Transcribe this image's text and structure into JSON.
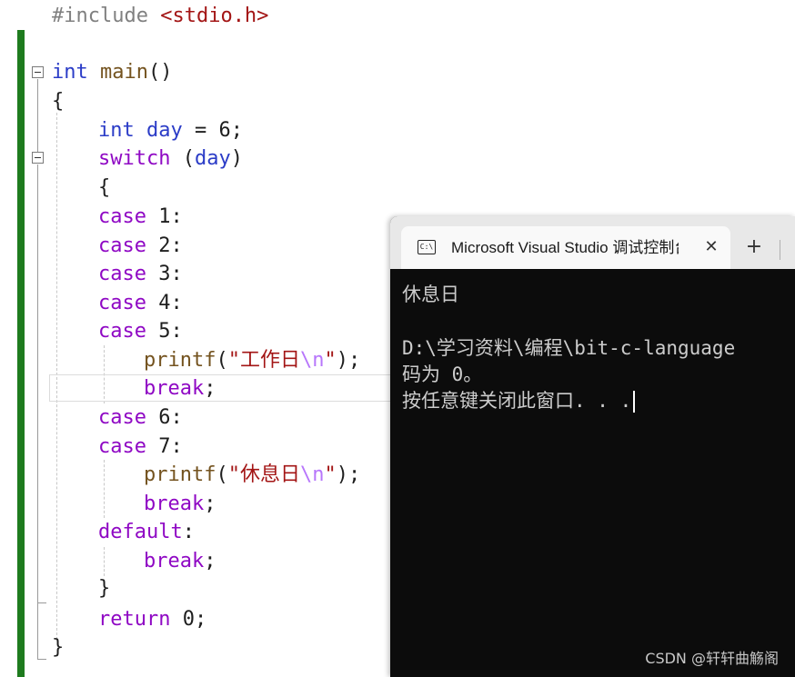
{
  "editor": {
    "lines": [
      {
        "id": "l1",
        "parts": [
          {
            "c": "pp",
            "t": "#include "
          },
          {
            "c": "str",
            "t": "<stdio.h>"
          }
        ]
      },
      {
        "id": "l2",
        "parts": []
      },
      {
        "id": "l3",
        "parts": [
          {
            "c": "kw",
            "t": "int"
          },
          {
            "c": "punct",
            "t": " "
          },
          {
            "c": "fn",
            "t": "main"
          },
          {
            "c": "punct",
            "t": "()"
          }
        ]
      },
      {
        "id": "l4",
        "parts": [
          {
            "c": "punct",
            "t": "{"
          }
        ]
      },
      {
        "id": "l5",
        "parts": [
          {
            "c": "kw",
            "t": "int"
          },
          {
            "c": "punct",
            "t": " "
          },
          {
            "c": "kw",
            "t": "day"
          },
          {
            "c": "punct",
            "t": " = 6;"
          }
        ]
      },
      {
        "id": "l6",
        "parts": [
          {
            "c": "ctl",
            "t": "switch"
          },
          {
            "c": "punct",
            "t": " ("
          },
          {
            "c": "kw",
            "t": "day"
          },
          {
            "c": "punct",
            "t": ")"
          }
        ]
      },
      {
        "id": "l7",
        "parts": [
          {
            "c": "punct",
            "t": "{"
          }
        ]
      },
      {
        "id": "l8",
        "parts": [
          {
            "c": "ctl",
            "t": "case"
          },
          {
            "c": "punct",
            "t": " 1:"
          }
        ]
      },
      {
        "id": "l9",
        "parts": [
          {
            "c": "ctl",
            "t": "case"
          },
          {
            "c": "punct",
            "t": " 2:"
          }
        ]
      },
      {
        "id": "l10",
        "parts": [
          {
            "c": "ctl",
            "t": "case"
          },
          {
            "c": "punct",
            "t": " 3:"
          }
        ]
      },
      {
        "id": "l11",
        "parts": [
          {
            "c": "ctl",
            "t": "case"
          },
          {
            "c": "punct",
            "t": " 4:"
          }
        ]
      },
      {
        "id": "l12",
        "parts": [
          {
            "c": "ctl",
            "t": "case"
          },
          {
            "c": "punct",
            "t": " 5:"
          }
        ]
      },
      {
        "id": "l13",
        "parts": [
          {
            "c": "fn",
            "t": "printf"
          },
          {
            "c": "punct",
            "t": "("
          },
          {
            "c": "str",
            "t": "\"工作日"
          },
          {
            "c": "esc",
            "t": "\\n"
          },
          {
            "c": "str",
            "t": "\""
          },
          {
            "c": "punct",
            "t": ");"
          }
        ]
      },
      {
        "id": "l14",
        "parts": [
          {
            "c": "ctl",
            "t": "break"
          },
          {
            "c": "punct",
            "t": ";"
          }
        ]
      },
      {
        "id": "l15",
        "parts": [
          {
            "c": "ctl",
            "t": "case"
          },
          {
            "c": "punct",
            "t": " 6:"
          }
        ]
      },
      {
        "id": "l16",
        "parts": [
          {
            "c": "ctl",
            "t": "case"
          },
          {
            "c": "punct",
            "t": " 7:"
          }
        ]
      },
      {
        "id": "l17",
        "parts": [
          {
            "c": "fn",
            "t": "printf"
          },
          {
            "c": "punct",
            "t": "("
          },
          {
            "c": "str",
            "t": "\"休息日"
          },
          {
            "c": "esc",
            "t": "\\n"
          },
          {
            "c": "str",
            "t": "\""
          },
          {
            "c": "punct",
            "t": ");"
          }
        ]
      },
      {
        "id": "l18",
        "parts": [
          {
            "c": "ctl",
            "t": "break"
          },
          {
            "c": "punct",
            "t": ";"
          }
        ]
      },
      {
        "id": "l19",
        "parts": [
          {
            "c": "ctl",
            "t": "default"
          },
          {
            "c": "punct",
            "t": ":"
          }
        ]
      },
      {
        "id": "l20",
        "parts": [
          {
            "c": "ctl",
            "t": "break"
          },
          {
            "c": "punct",
            "t": ";"
          }
        ]
      },
      {
        "id": "l21",
        "parts": [
          {
            "c": "punct",
            "t": "}"
          }
        ]
      },
      {
        "id": "l22",
        "parts": [
          {
            "c": "ctl",
            "t": "return"
          },
          {
            "c": "punct",
            "t": " 0;"
          }
        ]
      },
      {
        "id": "l23",
        "parts": [
          {
            "c": "punct",
            "t": "}"
          }
        ]
      }
    ],
    "colors": {
      "keyword": "#2b3cc7",
      "control": "#8f08c4",
      "function": "#74531f",
      "string": "#a31515",
      "escape": "#b776fb",
      "change_bar": "#1e7b1e"
    }
  },
  "console": {
    "tab_icon_text": "C:\\",
    "tab_title": "Microsoft Visual Studio 调试控制台",
    "close_glyph": "✕",
    "new_tab_glyph": "+",
    "output": [
      "休息日",
      "",
      "D:\\学习资料\\编程\\bit-c-language",
      "码为 0。",
      "按任意键关闭此窗口. . ."
    ]
  },
  "watermark": "CSDN @轩轩曲觞阁"
}
